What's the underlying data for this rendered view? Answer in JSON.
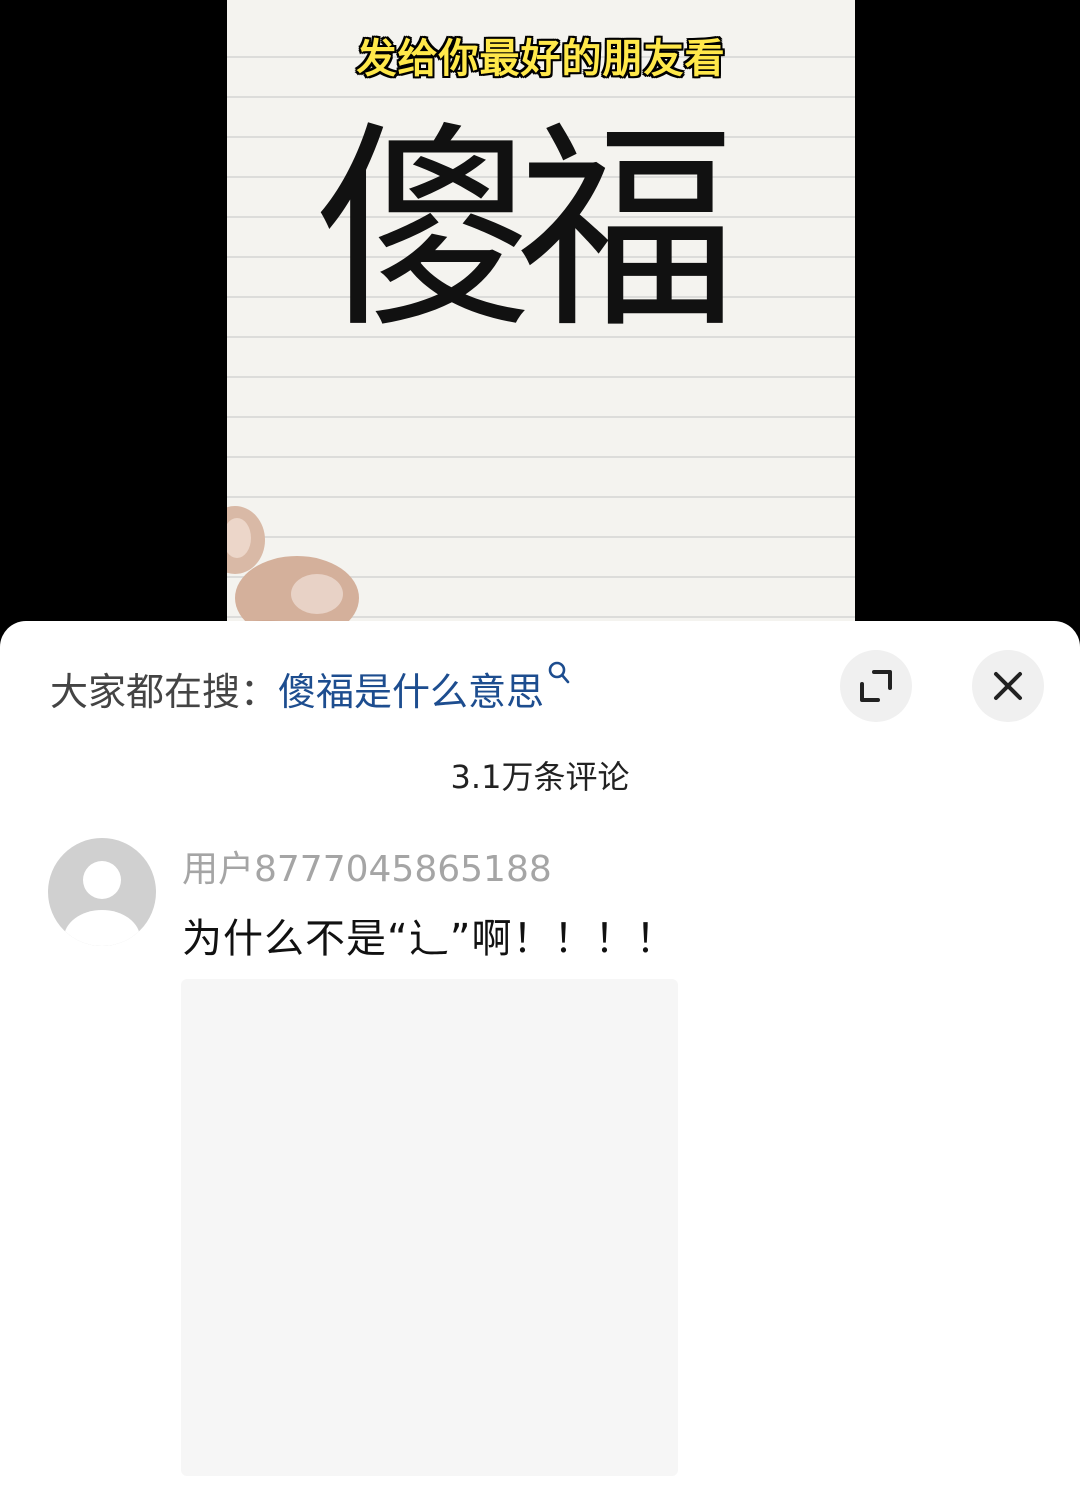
{
  "video": {
    "subtitle": "发给你最好的朋友看",
    "handwriting": "傻福"
  },
  "panel": {
    "search_prefix": "大家都在搜：",
    "search_query": "傻福是什么意思",
    "comment_count": "3.1万条评论"
  },
  "comment": {
    "username": "用户8777045865188",
    "text": "为什么不是“辶”啊！！！！"
  },
  "icons": {
    "search": "search-icon",
    "expand": "expand-icon",
    "close": "close-icon",
    "avatar": "default-avatar-icon"
  },
  "colors": {
    "query_link": "#1d4d8f",
    "subtitle": "#ffe84a",
    "username": "#a5a5a5"
  }
}
